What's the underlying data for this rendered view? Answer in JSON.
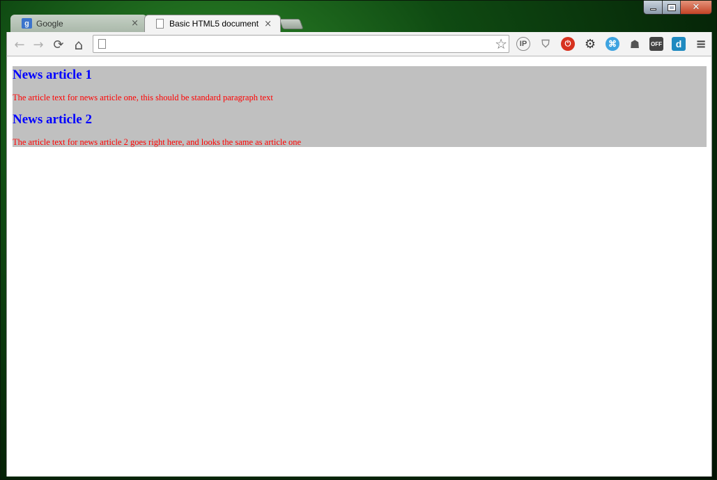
{
  "browser": {
    "tabs": [
      {
        "title": "Google",
        "active": false
      },
      {
        "title": "Basic HTML5 document",
        "active": true
      }
    ],
    "tab_close_glyph": "×",
    "address": {
      "value": "",
      "placeholder": ""
    },
    "nav": {
      "back": "←",
      "forward": "→",
      "reload": "⟳",
      "home": "⌂"
    },
    "extensions": {
      "ip": "IP",
      "red": "⏻",
      "gear": "⚙",
      "blue": "⌘",
      "ghost": "👻",
      "off": "OFF",
      "d": "d",
      "menu": "≡",
      "star": "☆"
    },
    "window_controls": {
      "close": "✕"
    },
    "google_favicon_letter": "g"
  },
  "page": {
    "articles": [
      {
        "heading": "News article 1",
        "text": "The article text for news article one, this should be standard paragraph text"
      },
      {
        "heading": "News article 2",
        "text": "The article text for news article 2 goes right here, and looks the same as article one"
      }
    ],
    "colors": {
      "heading": "#0000ff",
      "text": "#ff0000",
      "article_bg": "#c0c0c0"
    }
  }
}
